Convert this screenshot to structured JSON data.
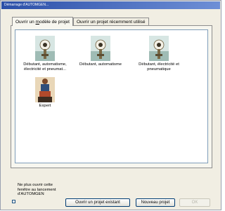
{
  "window": {
    "title": "Démarrage d'AUTOMGEN..."
  },
  "tabs": [
    {
      "label_before": "Ouvrir un ",
      "label_underline": "m",
      "label_after": "odèle de projet",
      "active": true
    },
    {
      "label": "Ouvrir un projet récemment utilisé",
      "active": false
    }
  ],
  "templates": [
    {
      "label": "Débutant, automatisme, électricité et pneumat...",
      "icon": "automgen-project-icon"
    },
    {
      "label": "Débutant, automatisme",
      "icon": "automgen-project-icon"
    },
    {
      "label": "Débutant, électricité et pneumatique",
      "icon": "automgen-project-icon"
    },
    {
      "label": "Expert",
      "icon": "expert-project-icon"
    }
  ],
  "bottom": {
    "checkbox_label": "Ne plus ouvrir cette fenêtre au lancement d'AUTOMGEN",
    "checkbox_checked": false,
    "open_existing_label": "Ouvrir un projet existant",
    "new_project_label": "Nouveau projet",
    "ok_label": "OK",
    "ok_enabled": false
  },
  "colors": {
    "dialog_bg": "#f1eee3",
    "titlebar_start": "#2c4fa8",
    "titlebar_end": "#6e8fd6",
    "list_bg": "#ffffff"
  }
}
